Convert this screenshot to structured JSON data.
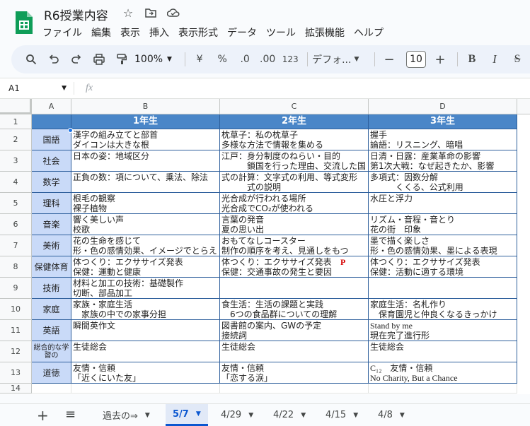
{
  "app": {
    "doc_title": "R6授業内容",
    "title_icons": [
      "star-icon",
      "move-to-folder-icon",
      "cloud-saved-icon"
    ],
    "menus": [
      "ファイル",
      "編集",
      "表示",
      "挿入",
      "表示形式",
      "データ",
      "ツール",
      "拡張機能",
      "ヘルプ"
    ]
  },
  "toolbar": {
    "zoom": "100%",
    "currency": "¥",
    "percent": "%",
    "decrease_decimal": ".0",
    "increase_decimal": ".00",
    "number_format": "123",
    "font": "デフォ...",
    "font_size": "10",
    "minus": "−",
    "plus": "+",
    "bold": "B",
    "italic": "I",
    "strike": "S"
  },
  "formula_bar": {
    "name_box": "A1",
    "fx": "fx"
  },
  "grid": {
    "columns": [
      "A",
      "B",
      "C",
      "D"
    ],
    "rows": [
      "1",
      "2",
      "3",
      "4",
      "5",
      "6",
      "7",
      "8",
      "9",
      "10",
      "11",
      "12",
      "13",
      "14"
    ],
    "header_row": [
      "1年生",
      "2年生",
      "3年生"
    ],
    "subjects": [
      "国語",
      "社会",
      "数学",
      "理科",
      "音楽",
      "美術",
      "保健体育",
      "技術",
      "家庭",
      "英語",
      "総合的な学習の",
      "道徳"
    ],
    "col_b": [
      "漢字の組み立てと部首\nダイコンは大きな根",
      "日本の姿：地域区分",
      "正負の数：項について、乗法、除法",
      "根毛の観察\n裸子植物",
      "響く美しい声\n校歌",
      "花の生命を感じて\n形・色の感情効果、イメージでとらえ",
      "体つくり：エクササイズ発表\n保健：運動と健康",
      "材料と加工の技術：基礎製作\n切断、部品加工",
      "家族・家庭生活\n　家族の中での家事分担",
      "瞬間英作文",
      "生徒総会",
      "友情・信頼\n「近くにいた友」"
    ],
    "col_c": [
      "枕草子：私の枕草子\n多様な方法で情報を集める",
      "江戸：身分制度のねらい・目的\n　　　鎖国を行った理由、交流した国",
      "式の計算：文字式の利用、等式変形\n　　　式の説明",
      "光合成が行われる場所\n光合成でCO₂が使われる",
      "言葉の発音\n夏の思い出",
      "おもてなしコースター\n制作の順序を考え、見通しをもつ",
      "体つくり：エクササイズ発表\n保健：交通事故の発生と要因",
      "",
      "食生活：生活の課題と実践\n　6つの食品群についての理解",
      "図書館の案内、GWの予定\n接続詞",
      "生徒総会",
      "友情・信頼\n「恋する涙」"
    ],
    "col_c_mark": "P",
    "col_d": [
      "握手\n論語：リスニング、暗唱",
      "日清・日露：産業革命の影響\n第1次大戦：なぜ起きたか、影響",
      "多項式：因数分解\n　　　くくる、公式利用",
      "水圧と浮力",
      "リズム・音程・音とり\n花の街　印象",
      "墨で描く楽しさ\n形・色の感情効果、墨による表現",
      "体つくり：エクササイズ発表\n保健：活動に適する環境",
      "",
      "家庭生活：名札作り\n　保育園児と仲良くなるきっかけ",
      "Stand by me\n現在完了進行形",
      "生徒総会",
      "C₁₂　友情・信頼\nNo Charity, But a Chance"
    ]
  },
  "sheet_tabs": {
    "add": "+",
    "list": "≡",
    "tabs": [
      "過去の⇒",
      "5/7",
      "4/29",
      "4/22",
      "4/15",
      "4/8"
    ],
    "active": "5/7"
  },
  "colors": {
    "header_fill": "#4a86c8",
    "subject_fill": "#c9daf8",
    "border": "#2e5f9c",
    "active_tab": "#0b57d0"
  }
}
